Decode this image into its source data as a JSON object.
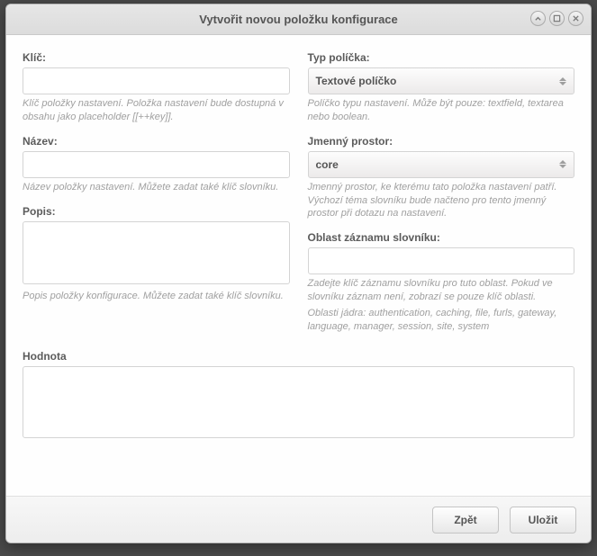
{
  "window": {
    "title": "Vytvořit novou položku konfigurace"
  },
  "left": {
    "key_label": "Klíč:",
    "key_help": "Klíč položky nastavení. Položka nastavení bude dostupná v obsahu jako placeholder [[++key]].",
    "name_label": "Název:",
    "name_help": "Název položky nastavení. Můžete zadat také klíč slovníku.",
    "desc_label": "Popis:",
    "desc_help": "Popis položky konfigurace. Můžete zadat také klíč slovníku."
  },
  "right": {
    "type_label": "Typ políčka:",
    "type_value": "Textové políčko",
    "type_help": "Políčko typu nastavení. Může být pouze: textfield, textarea nebo boolean.",
    "ns_label": "Jmenný prostor:",
    "ns_value": "core",
    "ns_help": "Jmenný prostor, ke kterému tato položka nastavení patří. Výchozí téma slovníku bude načteno pro tento jmenný prostor při dotazu na nastavení.",
    "area_label": "Oblast záznamu slovníku:",
    "area_help1": "Zadejte klíč záznamu slovníku pro tuto oblast. Pokud ve slovníku záznam není, zobrazí se pouze klíč oblasti.",
    "area_help2": "Oblasti jádra: authentication, caching, file, furls, gateway, language, manager, session, site, system"
  },
  "value_label": "Hodnota",
  "buttons": {
    "back": "Zpět",
    "save": "Uložit"
  }
}
